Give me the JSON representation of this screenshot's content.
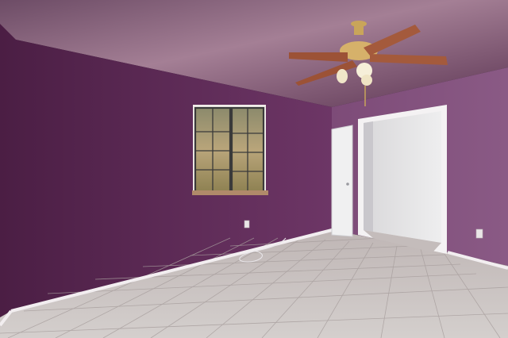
{
  "scene": {
    "description_free": true,
    "watermark_text": "",
    "colors": {
      "wall_back": "#6e3a68",
      "wall_left": "#6a2f5c",
      "wall_right": "#7a4574",
      "ceiling": "#9b6a8a",
      "floor": "#c9c1bd",
      "trim": "#efe9ea",
      "door": "#ededee",
      "fan_blade": "#a0553a",
      "fan_brass": "#c9a55a"
    }
  }
}
